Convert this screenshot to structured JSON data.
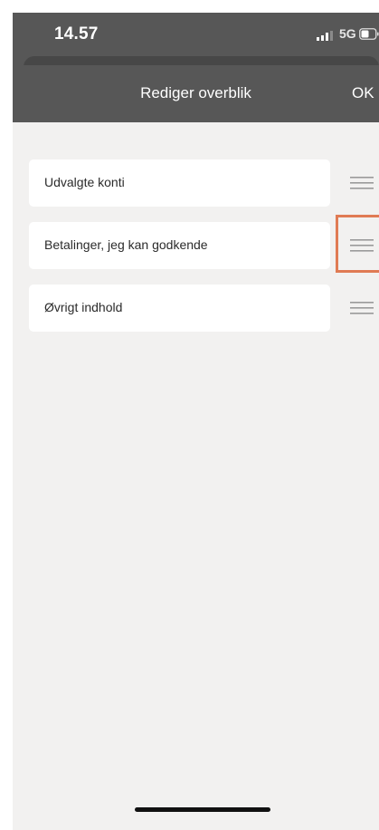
{
  "status_bar": {
    "time": "14.57",
    "network": "5G",
    "icons": [
      "signal-bars-icon",
      "battery-icon"
    ]
  },
  "nav": {
    "title": "Rediger overblik",
    "ok_label": "OK"
  },
  "list": {
    "items": [
      {
        "label": "Udvalgte konti",
        "handle_icon": "drag-handle-icon"
      },
      {
        "label": "Betalinger, jeg kan godkende",
        "handle_icon": "drag-handle-icon",
        "highlighted": true
      },
      {
        "label": "Øvrigt indhold",
        "handle_icon": "drag-handle-icon"
      }
    ]
  },
  "colors": {
    "header_background": "#575757",
    "page_background": "#f2f1f0",
    "card_background": "#ffffff",
    "highlight": "#e07b54",
    "handle": "#9a9a9a"
  }
}
